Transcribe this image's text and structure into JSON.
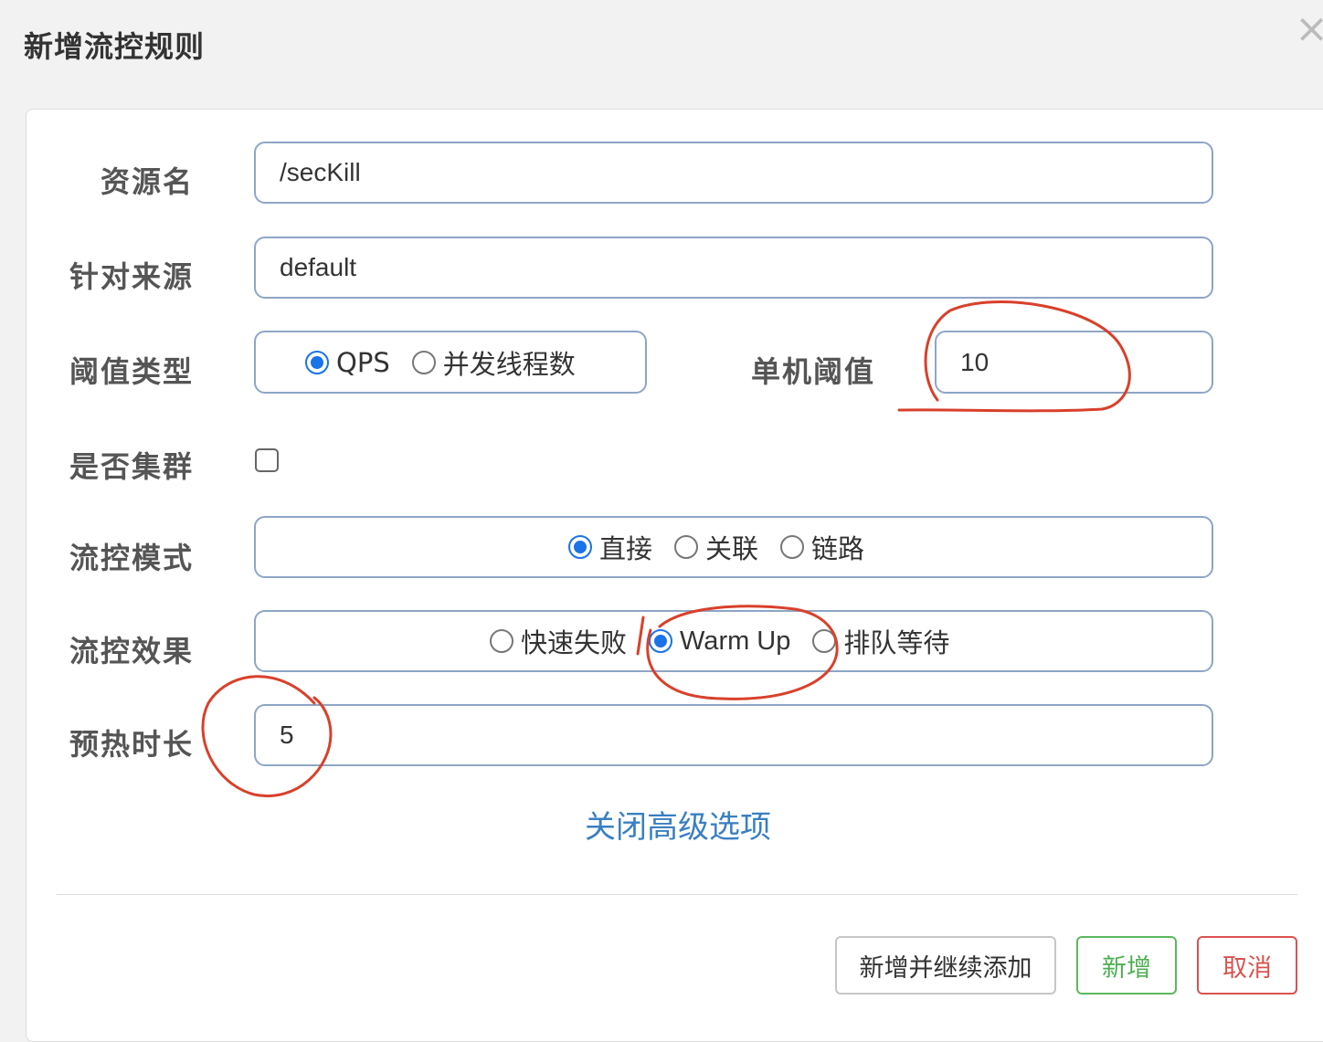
{
  "dialog": {
    "title": "新增流控规则",
    "close": "×"
  },
  "form": {
    "resource": {
      "label": "资源名",
      "value": "/secKill"
    },
    "source": {
      "label": "针对来源",
      "value": "default"
    },
    "threshold_type": {
      "label": "阈值类型",
      "options": [
        {
          "label": "QPS",
          "selected": true
        },
        {
          "label": "并发线程数",
          "selected": false
        }
      ]
    },
    "single_threshold": {
      "label": "单机阈值",
      "value": "10"
    },
    "cluster": {
      "label": "是否集群",
      "checked": false
    },
    "control_mode": {
      "label": "流控模式",
      "options": [
        {
          "label": "直接",
          "selected": true
        },
        {
          "label": "关联",
          "selected": false
        },
        {
          "label": "链路",
          "selected": false
        }
      ]
    },
    "control_effect": {
      "label": "流控效果",
      "options": [
        {
          "label": "快速失败",
          "selected": false
        },
        {
          "label": "Warm Up",
          "selected": true
        },
        {
          "label": "排队等待",
          "selected": false
        }
      ]
    },
    "warmup_period": {
      "label": "预热时长",
      "value": "5"
    },
    "advanced_link": "关闭高级选项"
  },
  "buttons": {
    "add_continue": "新增并继续添加",
    "add": "新增",
    "cancel": "取消"
  },
  "colors": {
    "accent": "#1a73e8",
    "link": "#3a7fc1",
    "add_button": "#4caf50",
    "cancel_button": "#d9534f",
    "annotation": "#d9402b"
  }
}
